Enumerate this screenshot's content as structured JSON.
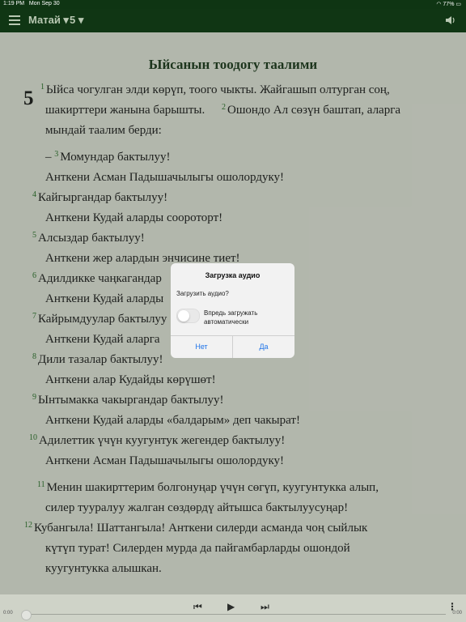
{
  "status_bar": {
    "time": "1:19 PM",
    "date": "Mon Sep 30",
    "battery": "77%"
  },
  "header": {
    "book": "Матай ▾",
    "chapter": "5 ▾",
    "menu_icon": "hamburger-icon",
    "audio_icon": "speaker-icon"
  },
  "content": {
    "heading": "Ыйсанын тоодогу таалими",
    "chapter_number": "5",
    "lines": [
      {
        "vn": "1",
        "text": "Ыйса чогулган элди көрүп, тоого чыкты. Жайгашып олтурган соң,"
      },
      {
        "vn": "",
        "text": "шакирттери жанына барышты."
      },
      {
        "vn": "2",
        "text": "Ошондо Ал сөзүн баштап, аларга"
      },
      {
        "vn": "",
        "text": "мындай таалим берди:"
      },
      {
        "vn": "3",
        "pre": "– ",
        "text": "Момундар бактылуу!"
      },
      {
        "vn": "",
        "text": "Анткени Асман Падышачылыгы ошолордуку!"
      },
      {
        "vn": "4",
        "text": "Кайгыргандар бактылуу!"
      },
      {
        "vn": "",
        "text": "Анткени Кудай аларды соороторт!"
      },
      {
        "vn": "5",
        "text": "Алсыздар бактылуу!"
      },
      {
        "vn": "",
        "text": "Анткени жер алардын энчисине тиет!"
      },
      {
        "vn": "6",
        "text": "Адилдикке чаңкагандар"
      },
      {
        "vn": "",
        "text": "Анткени Кудай аларды"
      },
      {
        "vn": "7",
        "text": "Кайрымдуулар бактылуу"
      },
      {
        "vn": "",
        "text": "Анткени Кудай аларга"
      },
      {
        "vn": "8",
        "text": "Дили тазалар бактылуу!"
      },
      {
        "vn": "",
        "text": "Анткени алар Кудайды көрүшөт!"
      },
      {
        "vn": "9",
        "text": "Ынтымакка чакыргандар бактылуу!"
      },
      {
        "vn": "",
        "text": "Анткени Кудай аларды «балдарым» деп чакырат!"
      },
      {
        "vn": "10",
        "text": "Адилеттик үчүн куугунтук жегендер бактылуу!"
      },
      {
        "vn": "",
        "text": "Анткени Асман Падышачылыгы ошолордуку!"
      },
      {
        "vn": "11",
        "text": "Менин шакирттерим болгонуңар үчүн сөгүп, куугунтукка алып,"
      },
      {
        "vn": "",
        "text": "силер тууралуу жалган сөздөрдү айтышса бактылуусуңар!"
      },
      {
        "vn": "12",
        "text": "Кубангыла! Шаттангыла! Анткени силерди асманда чоң сыйлык"
      },
      {
        "vn": "",
        "text": "күтүп турат! Силерден мурда да пайгамбарларды ошондой"
      },
      {
        "vn": "",
        "text": "куугунтукка алышкан."
      }
    ]
  },
  "player": {
    "prev_icon": "skip-back-icon",
    "play_icon": "play-icon",
    "next_icon": "skip-forward-icon",
    "more_icon": "more-vertical-icon",
    "elapsed": "0:00",
    "remaining": "0:00",
    "progress_percent": 0
  },
  "dialog": {
    "title": "Загрузка аудио",
    "message": "Загрузить аудио?",
    "toggle_label": "Впредь загружать автоматически",
    "toggle_on": false,
    "no_label": "Нет",
    "yes_label": "Да"
  }
}
